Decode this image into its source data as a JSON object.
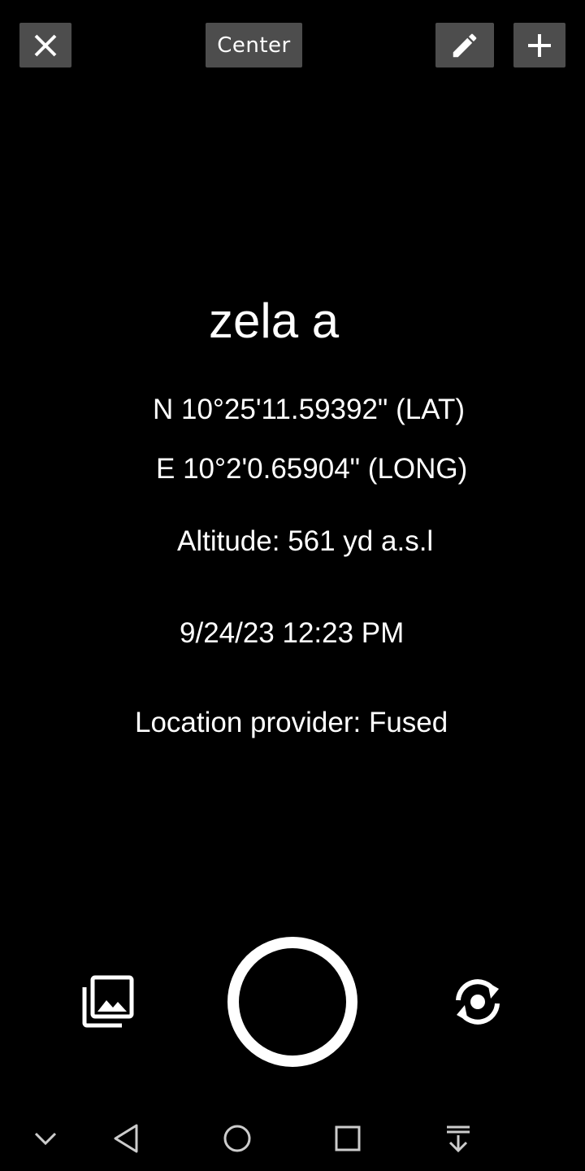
{
  "toolbar": {
    "close_icon": "close-icon",
    "center_label": "Center",
    "edit_icon": "pencil-icon",
    "add_icon": "plus-icon",
    "button_color": "#4d4d4d"
  },
  "location": {
    "name": "zela a",
    "latitude": "N 10°25'11.59392\" (LAT)",
    "longitude": "E 10°2'0.65904\" (LONG)",
    "altitude": "Altitude: 561 yd a.s.l",
    "datetime": "9/24/23 12:23 PM",
    "provider": "Location provider: Fused"
  },
  "camera_controls": {
    "gallery_icon": "gallery-icon",
    "shutter_icon": "shutter-button",
    "switch_icon": "switch-camera-icon"
  },
  "system_nav": {
    "items": [
      "chevron-down-icon",
      "back-icon",
      "home-icon",
      "recents-icon",
      "download-icon"
    ]
  },
  "colors": {
    "background": "#000000",
    "foreground": "#ffffff"
  }
}
